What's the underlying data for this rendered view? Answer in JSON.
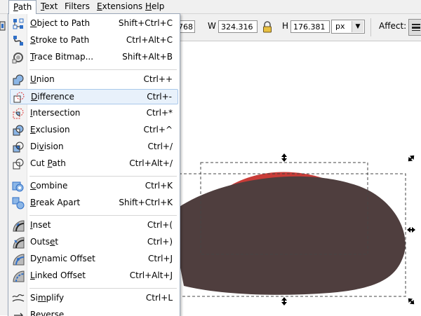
{
  "menubar": {
    "items": [
      {
        "label": "Path",
        "mnemonic": "P",
        "rest": "ath",
        "active": true
      },
      {
        "label": "Text",
        "mnemonic": "T",
        "rest": "ext"
      },
      {
        "label": "Filters",
        "mnemonic": "",
        "rest": "Filters"
      },
      {
        "label": "Extensions",
        "mnemonic": "E",
        "rest": "xtensions"
      },
      {
        "label": "Help",
        "mnemonic": "H",
        "rest": "elp"
      }
    ]
  },
  "toolbar": {
    "y_value_partial": "768",
    "w_label": "W",
    "w_value": "324.316",
    "h_label": "H",
    "h_value": "176.381",
    "unit": "px",
    "affect_label": "Affect:"
  },
  "path_menu": {
    "items": [
      {
        "pre": "",
        "mn": "O",
        "post": "bject to Path",
        "shortcut": "Shift+Ctrl+C",
        "icon": "object-to-path-icon"
      },
      {
        "pre": "",
        "mn": "S",
        "post": "troke to Path",
        "shortcut": "Ctrl+Alt+C",
        "icon": "stroke-to-path-icon"
      },
      {
        "pre": "",
        "mn": "T",
        "post": "race Bitmap...",
        "shortcut": "Shift+Alt+B",
        "icon": "trace-bitmap-icon"
      },
      {
        "pre": "",
        "mn": "U",
        "post": "nion",
        "shortcut": "Ctrl++",
        "icon": "union-icon"
      },
      {
        "pre": "",
        "mn": "D",
        "post": "ifference",
        "shortcut": "Ctrl+-",
        "icon": "difference-icon",
        "hover": true
      },
      {
        "pre": "",
        "mn": "I",
        "post": "ntersection",
        "shortcut": "Ctrl+*",
        "icon": "intersection-icon"
      },
      {
        "pre": "",
        "mn": "E",
        "post": "xclusion",
        "shortcut": "Ctrl+^",
        "icon": "exclusion-icon"
      },
      {
        "pre": "Di",
        "mn": "v",
        "post": "ision",
        "shortcut": "Ctrl+/",
        "icon": "division-icon"
      },
      {
        "pre": "Cut ",
        "mn": "P",
        "post": "ath",
        "shortcut": "Ctrl+Alt+/",
        "icon": "cut-path-icon"
      },
      {
        "pre": "",
        "mn": "C",
        "post": "ombine",
        "shortcut": "Ctrl+K",
        "icon": "combine-icon"
      },
      {
        "pre": "",
        "mn": "B",
        "post": "reak Apart",
        "shortcut": "Shift+Ctrl+K",
        "icon": "break-apart-icon"
      },
      {
        "pre": "",
        "mn": "I",
        "post": "nset",
        "shortcut": "Ctrl+(",
        "icon": "inset-icon"
      },
      {
        "pre": "Outs",
        "mn": "e",
        "post": "t",
        "shortcut": "Ctrl+)",
        "icon": "outset-icon"
      },
      {
        "pre": "D",
        "mn": "y",
        "post": "namic Offset",
        "shortcut": "Ctrl+J",
        "icon": "dynamic-offset-icon"
      },
      {
        "pre": "",
        "mn": "L",
        "post": "inked Offset",
        "shortcut": "Ctrl+Alt+J",
        "icon": "linked-offset-icon"
      },
      {
        "pre": "Si",
        "mn": "m",
        "post": "plify",
        "shortcut": "Ctrl+L",
        "icon": "simplify-icon"
      },
      {
        "pre": "",
        "mn": "R",
        "post": "everse",
        "shortcut": "",
        "icon": "reverse-icon"
      }
    ]
  },
  "colors": {
    "menu_bg": "#ffffff",
    "menubar_bg": "#f0f0f0",
    "hover_bg": "#e8f1fb",
    "hover_border": "#a9c8ea",
    "shape_dark": "#4f3e3e",
    "shape_red": "#c93c38",
    "icon_blue": "#2f6fc7"
  }
}
